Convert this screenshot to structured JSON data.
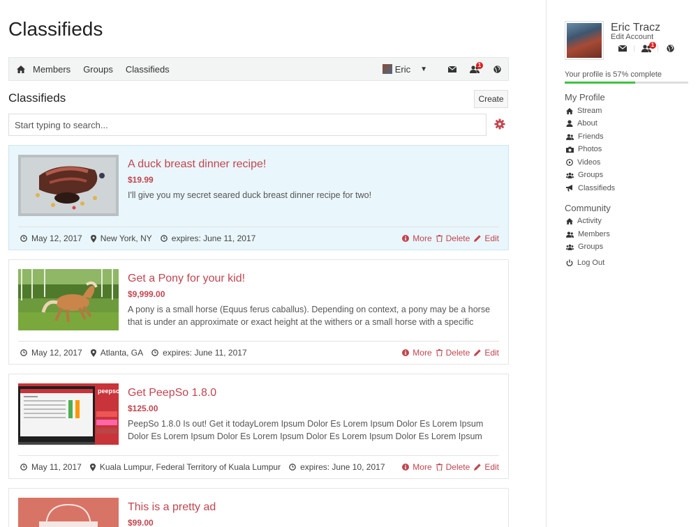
{
  "page": {
    "title": "Classifieds"
  },
  "nav": {
    "links": [
      "Members",
      "Groups",
      "Classifieds"
    ],
    "user_name": "Eric",
    "friends_badge": "1"
  },
  "section": {
    "title": "Classifieds",
    "create_label": "Create"
  },
  "search": {
    "placeholder": "Start typing to search..."
  },
  "listings": [
    {
      "title": "A duck breast dinner recipe!",
      "price": "$19.99",
      "description": "I'll give you my secret seared duck breast dinner recipe for two!",
      "date": "May 12, 2017",
      "location": "New York, NY",
      "expires": "expires: June 11, 2017"
    },
    {
      "title": "Get a Pony for your kid!",
      "price": "$9,999.00",
      "description": "A pony is a small horse (Equus ferus caballus). Depending on context, a pony may be a horse that is under an approximate or exact height at the withers or a small horse with a specific",
      "date": "May 12, 2017",
      "location": "Atlanta, GA",
      "expires": "expires: June 11, 2017"
    },
    {
      "title": "Get PeepSo 1.8.0",
      "price": "$125.00",
      "description": "PeepSo 1.8.0 Is out! Get it todayLorem Ipsum Dolor Es Lorem Ipsum Dolor Es Lorem Ipsum Dolor Es Lorem Ipsum Dolor Es Lorem Ipsum Dolor Es Lorem Ipsum Dolor Es Lorem Ipsum",
      "date": "May 11, 2017",
      "location": "Kuala Lumpur, Federal Territory of Kuala Lumpur",
      "expires": "expires: June 10, 2017"
    },
    {
      "title": "This is a pretty ad",
      "price": "$99.00"
    }
  ],
  "actions": {
    "more": "More",
    "delete": "Delete",
    "edit": "Edit"
  },
  "profile": {
    "name": "Eric Tracz",
    "edit_account": "Edit Account",
    "friends_badge": "1",
    "completion_text": "Your profile is 57% complete",
    "completion_percent": 57
  },
  "my_profile": {
    "heading": "My Profile",
    "items": [
      "Stream",
      "About",
      "Friends",
      "Photos",
      "Videos",
      "Groups",
      "Classifieds"
    ]
  },
  "community": {
    "heading": "Community",
    "items": [
      "Activity",
      "Members",
      "Groups"
    ],
    "logout": "Log Out"
  },
  "colors": {
    "accent": "#c2454f",
    "highlight_bg": "#e9f6fb",
    "progress": "#3ec241",
    "badge": "#e01e1e"
  }
}
